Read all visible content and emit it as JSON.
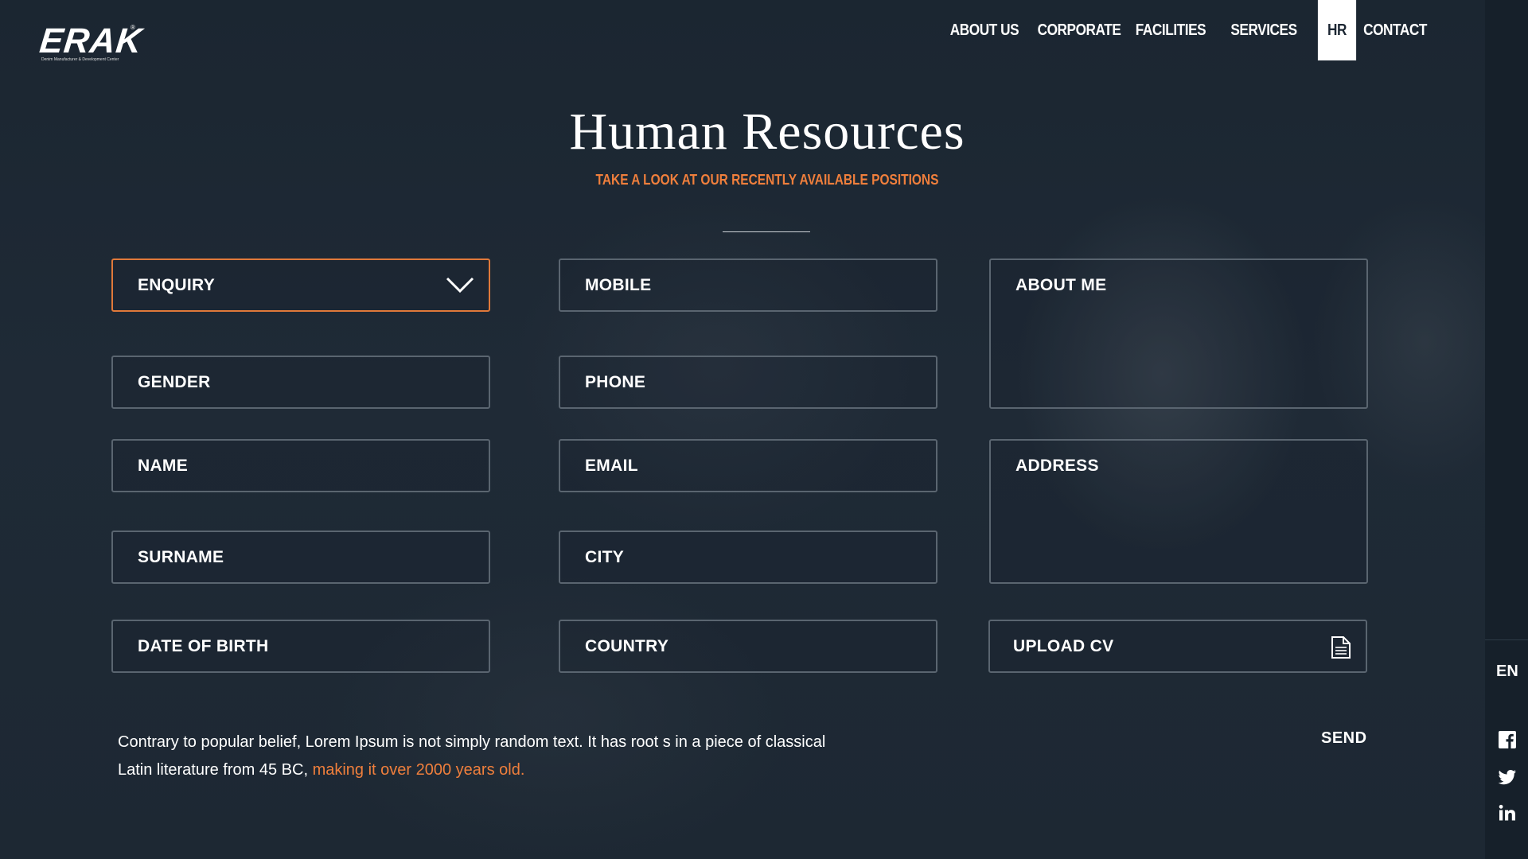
{
  "brand": {
    "logo_text": "ERAK",
    "tagline": "Denim Manufacturer & Development Center"
  },
  "nav": {
    "items": [
      {
        "label": "ABOUT US"
      },
      {
        "label": "CORPORATE"
      },
      {
        "label": "FACILITIES"
      },
      {
        "label": "SERVICES"
      },
      {
        "label": "HR",
        "active": true
      },
      {
        "label": "CONTACT"
      }
    ]
  },
  "hero": {
    "title": "Human Resources",
    "subtitle": "TAKE A LOOK AT OUR RECENTLY AVAILABLE POSITIONS"
  },
  "form": {
    "enquiry": "ENQUIRY",
    "gender": "GENDER",
    "name": "NAME",
    "surname": "SURNAME",
    "date_of_birth": "DATE OF BIRTH",
    "mobile": "MOBILE",
    "phone": "PHONE",
    "email": "EMAIL",
    "city": "CITY",
    "country": "COUNTRY",
    "about_me": "ABOUT ME",
    "address": "ADDRESS",
    "upload_cv": "UPLOAD CV",
    "send": "SEND"
  },
  "note": {
    "text": "Contrary to popular belief, Lorem Ipsum is not simply random text. It has root s in a piece of classical Latin literature from 45 BC, ",
    "link": "making it over 2000 years old."
  },
  "sidebar": {
    "language": "EN",
    "social_icons": [
      "facebook-icon",
      "twitter-icon",
      "linkedin-icon"
    ]
  },
  "colors": {
    "background": "#1c2733",
    "accent": "#f07f3c",
    "field_border": "#5a6570",
    "active_nav_bg": "#ffffff"
  }
}
